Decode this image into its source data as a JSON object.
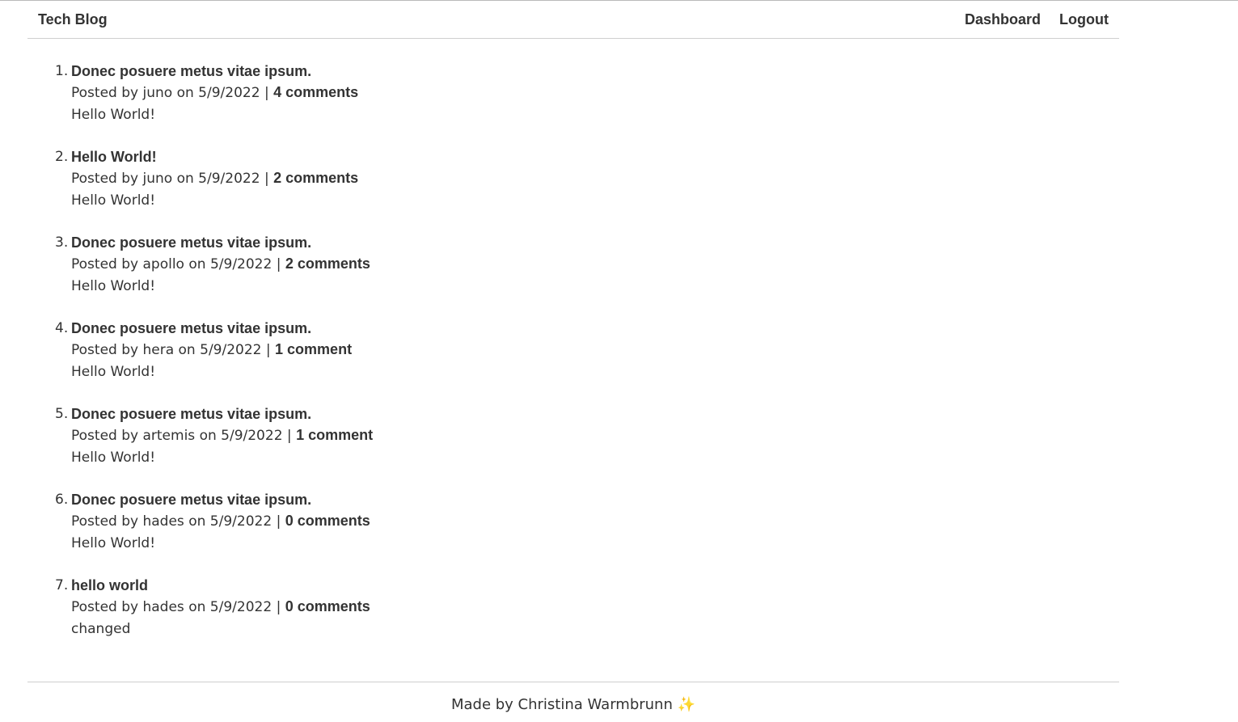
{
  "header": {
    "brand": "Tech Blog",
    "nav": [
      {
        "label": "Dashboard"
      },
      {
        "label": "Logout"
      }
    ]
  },
  "posts": [
    {
      "number": "1.",
      "title": "Donec posuere metus vitae ipsum.",
      "prefix": "Posted by",
      "author": "juno",
      "on": "on",
      "date": "5/9/2022",
      "sep": "|",
      "comments": "4 comments",
      "body": "Hello World!"
    },
    {
      "number": "2.",
      "title": "Hello World!",
      "prefix": "Posted by",
      "author": "juno",
      "on": "on",
      "date": "5/9/2022",
      "sep": "|",
      "comments": "2 comments",
      "body": "Hello World!"
    },
    {
      "number": "3.",
      "title": "Donec posuere metus vitae ipsum.",
      "prefix": "Posted by",
      "author": "apollo",
      "on": "on",
      "date": "5/9/2022",
      "sep": "|",
      "comments": "2 comments",
      "body": "Hello World!"
    },
    {
      "number": "4.",
      "title": "Donec posuere metus vitae ipsum.",
      "prefix": "Posted by",
      "author": "hera",
      "on": "on",
      "date": "5/9/2022",
      "sep": "|",
      "comments": "1 comment",
      "body": "Hello World!"
    },
    {
      "number": "5.",
      "title": "Donec posuere metus vitae ipsum.",
      "prefix": "Posted by",
      "author": "artemis",
      "on": "on",
      "date": "5/9/2022",
      "sep": "|",
      "comments": "1 comment",
      "body": "Hello World!"
    },
    {
      "number": "6.",
      "title": "Donec posuere metus vitae ipsum.",
      "prefix": "Posted by",
      "author": "hades",
      "on": "on",
      "date": "5/9/2022",
      "sep": "|",
      "comments": "0 comments",
      "body": "Hello World!"
    },
    {
      "number": "7.",
      "title": "hello world",
      "prefix": "Posted by",
      "author": "hades",
      "on": "on",
      "date": "5/9/2022",
      "sep": "|",
      "comments": "0 comments",
      "body": "changed"
    }
  ],
  "footer": {
    "text": "Made by Christina Warmbrunn",
    "icon": "✨",
    "icon_name": "sparkles-icon",
    "icon_color": "#f2c12e"
  },
  "colors": {
    "text": "#333333",
    "divider": "#cfcfcf",
    "background": "#ffffff"
  }
}
